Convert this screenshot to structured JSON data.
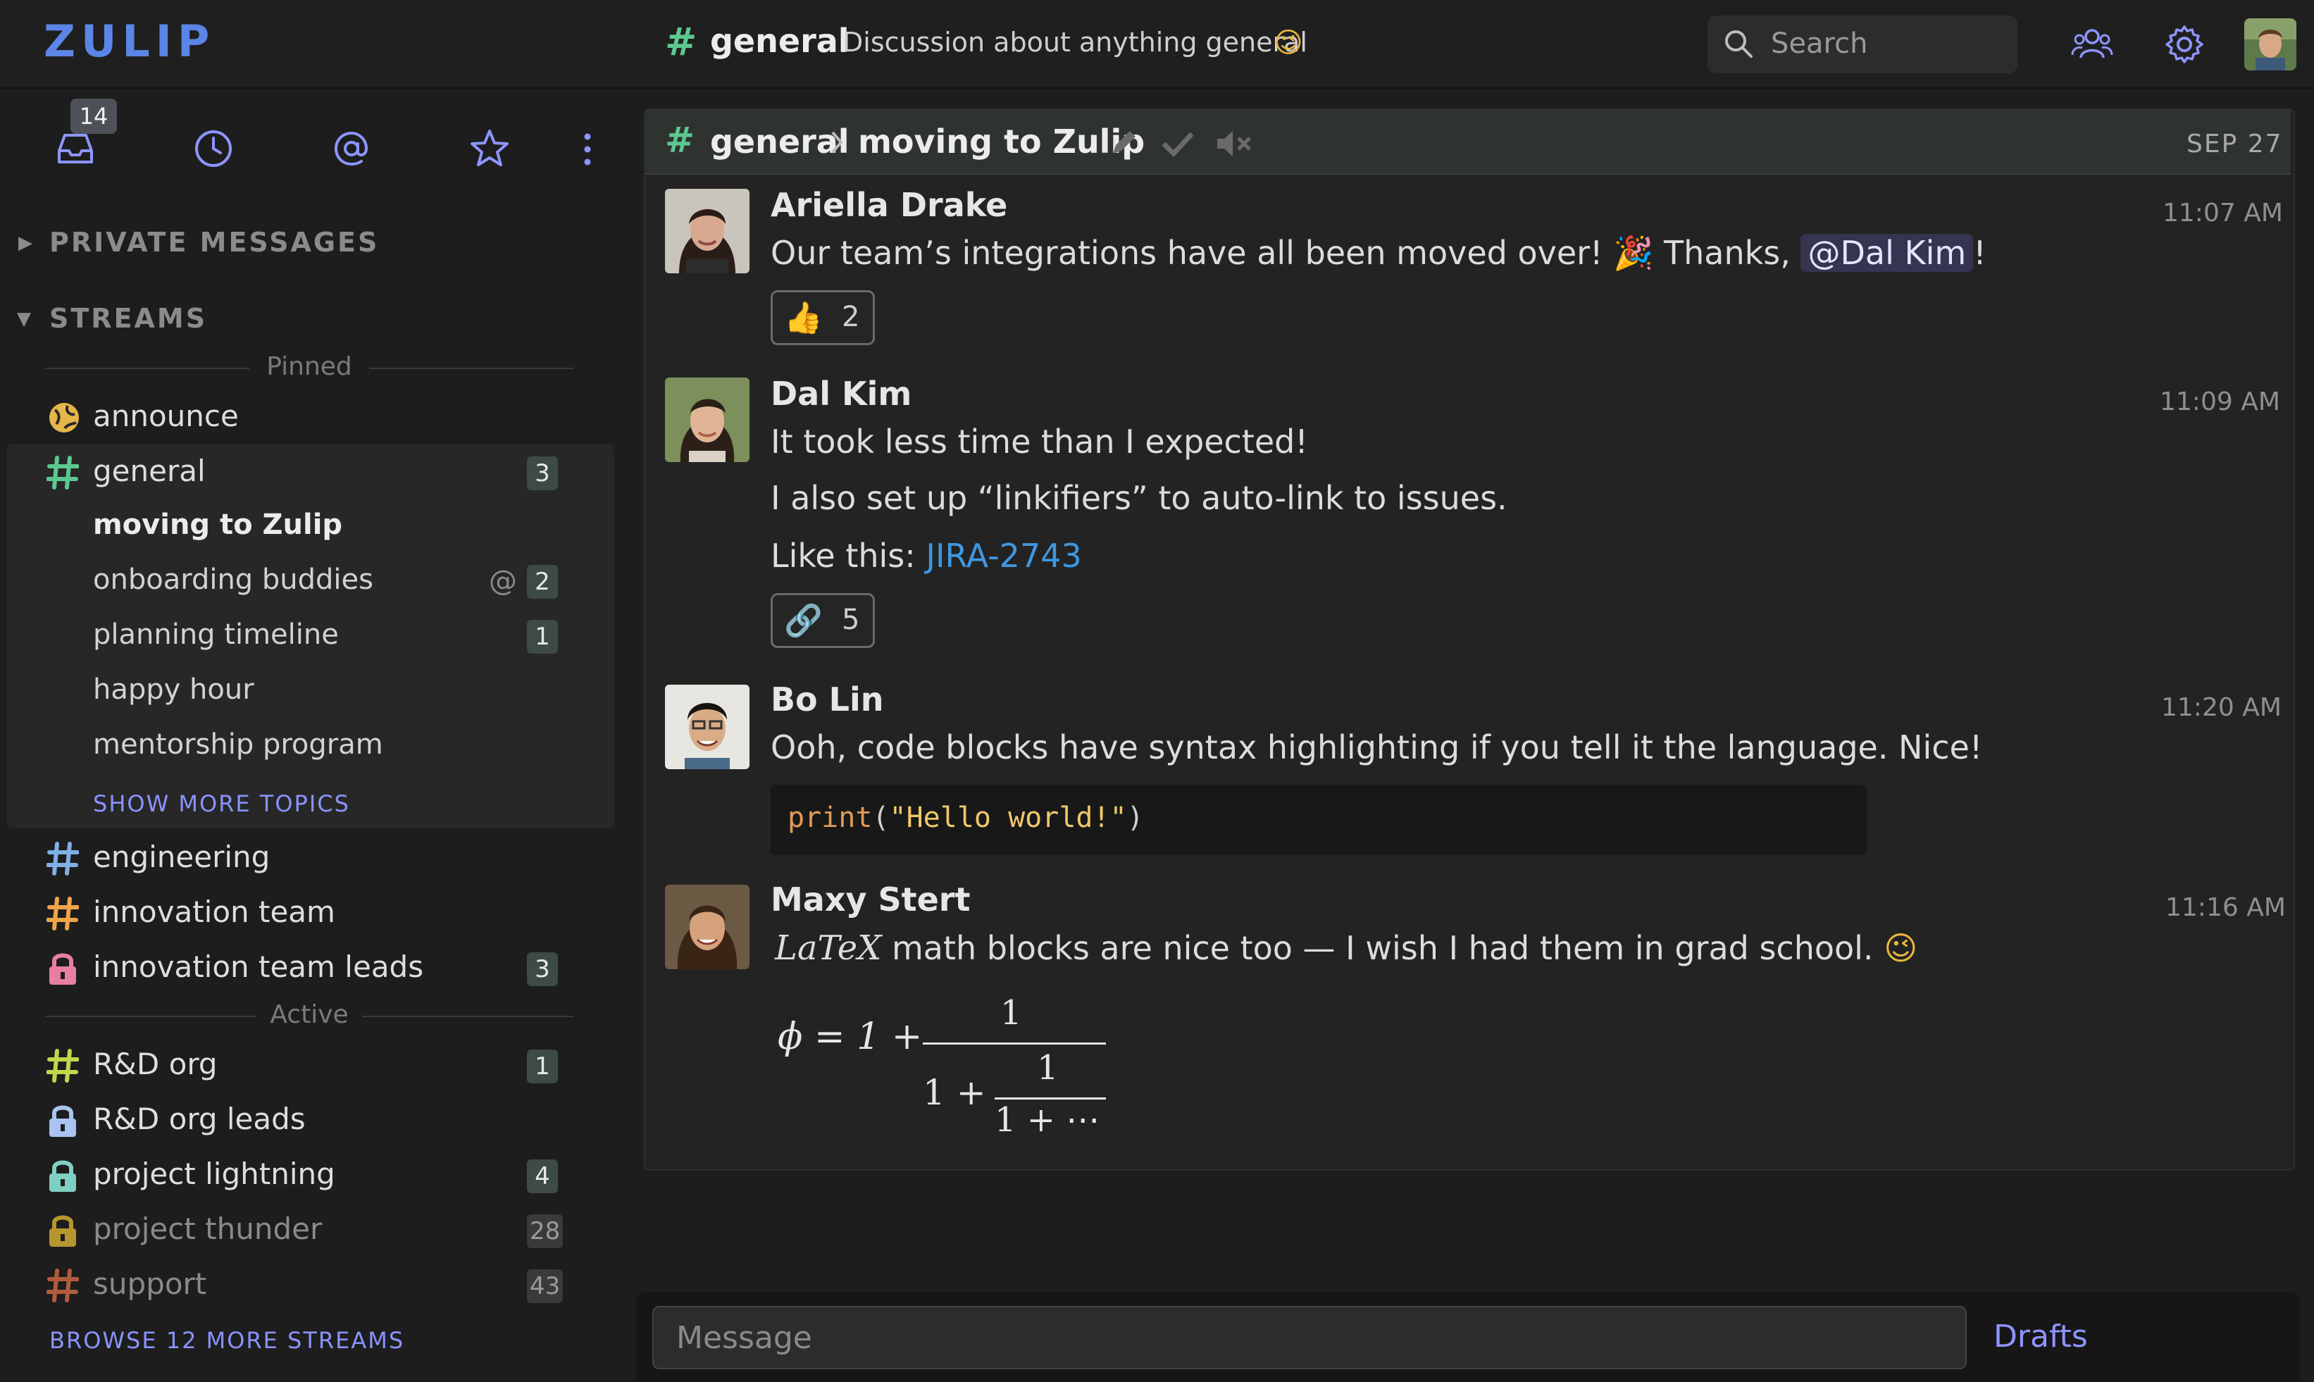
{
  "topbar": {
    "logo": "ZULIP",
    "stream_name": "general",
    "stream_description": "Discussion about anything general",
    "description_emoji": "😉",
    "search_placeholder": "Search"
  },
  "nav": {
    "inbox_count": "14"
  },
  "sidebar": {
    "private_messages_label": "PRIVATE MESSAGES",
    "streams_label": "STREAMS",
    "pinned_label": "Pinned",
    "active_label": "Active",
    "pinned_streams": [
      {
        "name": "announce",
        "icon": "globe-icon",
        "color": "#e5b64a",
        "count": ""
      },
      {
        "name": "general",
        "icon": "hash-icon",
        "color": "#5cc890",
        "count": "3"
      }
    ],
    "general_topics": [
      {
        "name": "moving to Zulip",
        "count": "",
        "mention": false,
        "active": true
      },
      {
        "name": "onboarding buddies",
        "count": "2",
        "mention": true,
        "active": false
      },
      {
        "name": "planning timeline",
        "count": "1",
        "mention": false,
        "active": false
      },
      {
        "name": "happy hour",
        "count": "",
        "mention": false,
        "active": false
      },
      {
        "name": "mentorship program",
        "count": "",
        "mention": false,
        "active": false
      }
    ],
    "show_more_topics": "SHOW MORE TOPICS",
    "more_pinned_streams": [
      {
        "name": "engineering",
        "icon": "hash-icon",
        "color": "#7fb0e6",
        "count": ""
      },
      {
        "name": "innovation team",
        "icon": "hash-icon",
        "color": "#f0a44a",
        "count": ""
      },
      {
        "name": "innovation team leads",
        "icon": "lock-icon",
        "color": "#e87fa0",
        "count": "3"
      }
    ],
    "active_streams": [
      {
        "name": "R&D org",
        "icon": "hash-icon",
        "color": "#c2d64a",
        "count": "1",
        "muted": false
      },
      {
        "name": "R&D org leads",
        "icon": "lock-icon",
        "color": "#a9c4f0",
        "count": "",
        "muted": false
      },
      {
        "name": "project lightning",
        "icon": "lock-icon",
        "color": "#7fd0c4",
        "count": "4",
        "muted": false
      },
      {
        "name": "project thunder",
        "icon": "lock-icon",
        "color": "#b8962e",
        "count": "28",
        "muted": true
      },
      {
        "name": "support",
        "icon": "hash-icon",
        "color": "#b05c3c",
        "count": "43",
        "muted": true
      }
    ],
    "browse_more": "BROWSE 12 MORE STREAMS"
  },
  "recipient_bar": {
    "stream": "general",
    "topic": "moving to Zulip",
    "date": "SEP 27"
  },
  "messages": [
    {
      "sender": "Ariella Drake",
      "time": "11:07 AM",
      "text_before": "Our team’s integrations have all been moved over!",
      "emoji": "🎉",
      "text_mid": "Thanks,",
      "mention": "@Dal Kim",
      "text_after": "!",
      "reaction": {
        "emoji": "👍",
        "count": "2"
      }
    },
    {
      "sender": "Dal Kim",
      "time": "11:09 AM",
      "line1": "It took less time than I expected!",
      "line2": "I also set up “linkifiers” to auto-link to issues.",
      "line3_prefix": "Like this:",
      "link": "JIRA-2743",
      "reaction": {
        "emoji": "🔗",
        "count": "5"
      }
    },
    {
      "sender": "Bo Lin",
      "time": "11:20 AM",
      "text": "Ooh, code blocks have syntax highlighting if you tell it the language. Nice!",
      "code_fn": "print",
      "code_open": "(",
      "code_str": "\"Hello world!\"",
      "code_close": ")"
    },
    {
      "sender": "Maxy Stert",
      "time": "11:16 AM",
      "latex_word": "LaTeX",
      "text": "math blocks are nice too — I wish I had them in grad school.",
      "emoji": "😉",
      "math_phi": "ϕ = 1 +",
      "math_num": "1",
      "math_den_prefix": "1 +",
      "math_inner_num": "1",
      "math_inner_den": "1 + ⋯"
    }
  ],
  "compose": {
    "placeholder": "Message",
    "drafts": "Drafts"
  },
  "colors": {
    "accent": "#8e95ff",
    "link": "#3f97e0",
    "logo": "#5b85e6"
  }
}
